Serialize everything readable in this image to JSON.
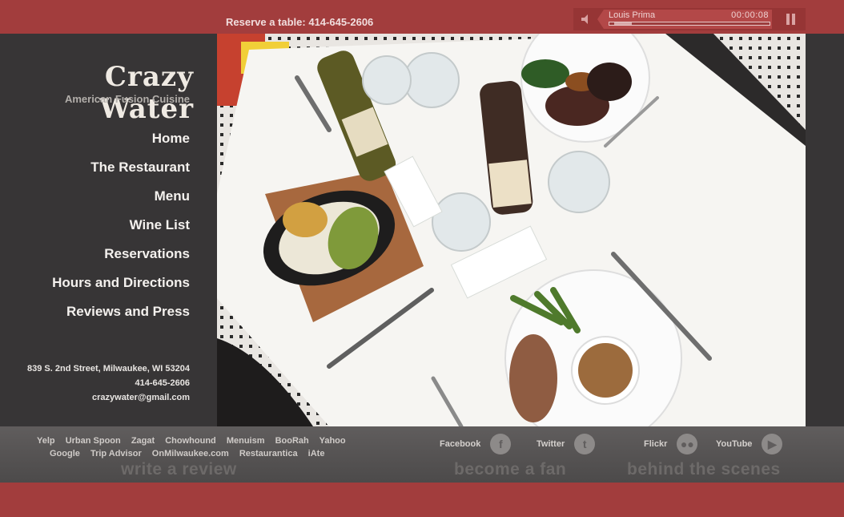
{
  "header": {
    "reserve_text": "Reserve a table: 414-645-2606"
  },
  "player": {
    "track_name": "Louis Prima",
    "time": "00:00:08",
    "progress": 0.03
  },
  "sidebar": {
    "logo": "Crazy Water",
    "tagline": "American Fusion Cuisine",
    "nav": [
      {
        "label": "Home"
      },
      {
        "label": "The Restaurant"
      },
      {
        "label": "Menu"
      },
      {
        "label": "Wine List"
      },
      {
        "label": "Reservations"
      },
      {
        "label": "Hours and Directions"
      },
      {
        "label": "Reviews and Press"
      }
    ],
    "contact": {
      "address": "839 S. 2nd Street, Milwaukee, WI 53204",
      "phone": "414-645-2606",
      "email": "crazywater@gmail.com"
    }
  },
  "footer": {
    "review_links_row1": [
      "Yelp",
      "Urban Spoon",
      "Zagat",
      "Chowhound",
      "Menuism",
      "BooRah",
      "Yahoo"
    ],
    "review_links_row2": [
      "Google",
      "Trip Advisor",
      "OnMilwaukee.com",
      "Restaurantica",
      "iAte"
    ],
    "write_review": "write a review",
    "become_fan": "become a fan",
    "behind_scenes": "behind the scenes",
    "social": [
      {
        "label": "Facebook",
        "icon": "facebook-icon",
        "glyph": "f"
      },
      {
        "label": "Twitter",
        "icon": "twitter-icon",
        "glyph": "t"
      },
      {
        "label": "Flickr",
        "icon": "flickr-icon",
        "glyph": "●●"
      },
      {
        "label": "YouTube",
        "icon": "youtube-icon",
        "glyph": "▶"
      }
    ]
  },
  "colors": {
    "brand_red": "#a23d3d",
    "sidebar_dark": "#373536",
    "footer_gray": "#575454"
  }
}
